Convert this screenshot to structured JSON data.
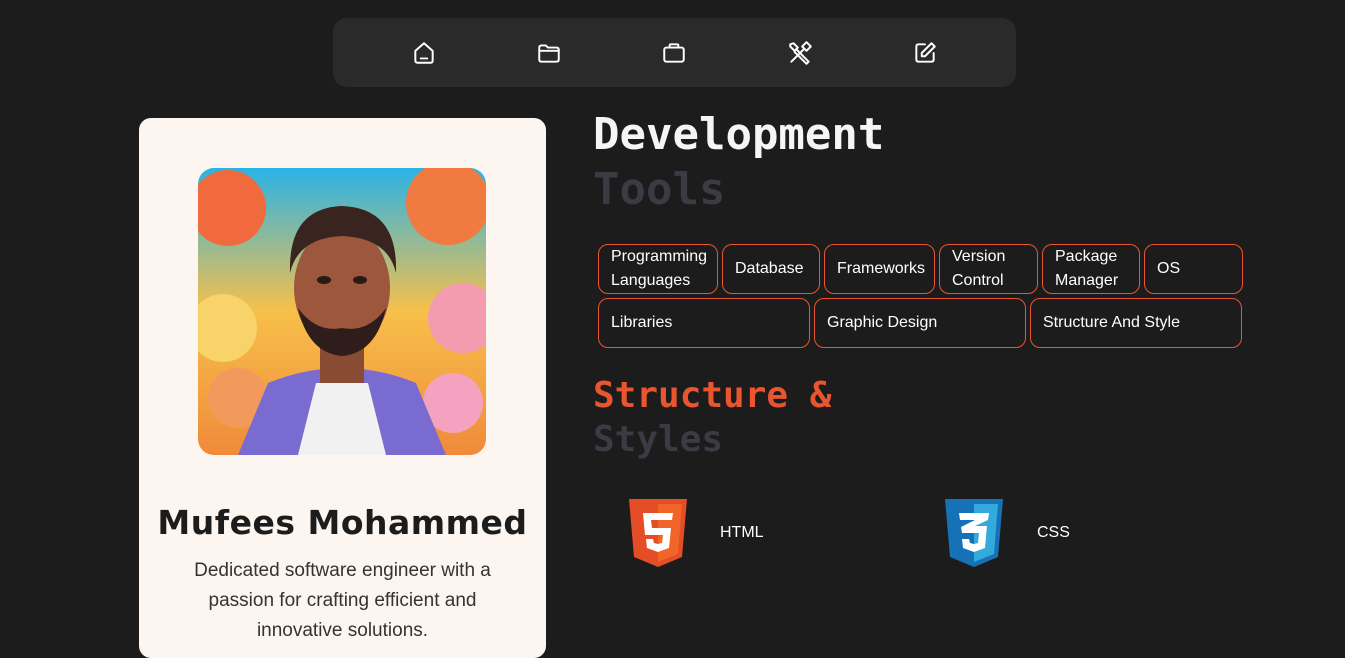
{
  "nav": {
    "items": [
      {
        "icon": "home-icon"
      },
      {
        "icon": "folder-icon"
      },
      {
        "icon": "briefcase-icon"
      },
      {
        "icon": "tools-icon"
      },
      {
        "icon": "edit-icon"
      }
    ]
  },
  "profile": {
    "name": "Mufees Mohammed",
    "bio": "Dedicated software engineer with a passion for crafting efficient and innovative solutions."
  },
  "section1": {
    "title": "Development",
    "subtitle": "Tools"
  },
  "categories": {
    "row1": [
      "Programming Languages",
      "Database",
      "Frameworks",
      "Version Control",
      "Package Manager",
      "OS"
    ],
    "row2": [
      "Libraries",
      "Graphic Design",
      "Structure And Style"
    ]
  },
  "section2": {
    "title": "Structure &",
    "subtitle": "Styles"
  },
  "technologies": [
    {
      "label": "HTML",
      "icon": "html5-icon",
      "color": "#e44d26"
    },
    {
      "label": "CSS",
      "icon": "css3-icon",
      "color": "#1572b6"
    }
  ],
  "colors": {
    "accent": "#e8552e",
    "background": "#1c1c1c",
    "card": "#fdf6f0"
  }
}
